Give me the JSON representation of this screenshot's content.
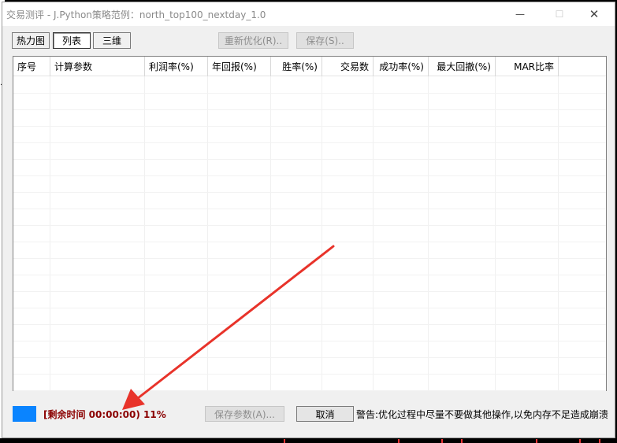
{
  "window": {
    "title": "交易测评 - J.Python策略范例：north_top100_nextday_1.0",
    "minimize_glyph": "—",
    "maximize_glyph": "☐",
    "close_glyph": "✕"
  },
  "toolbar": {
    "tabs": [
      {
        "label": "热力图",
        "active": false
      },
      {
        "label": "列表",
        "active": true
      },
      {
        "label": "三维",
        "active": false
      }
    ],
    "reoptimize_label": "重新优化(R)..",
    "save_label": "保存(S).."
  },
  "table": {
    "columns": [
      "序号",
      "计算参数",
      "利润率(%)",
      "年回报(%)",
      "胜率(%)",
      "交易数",
      "成功率(%)",
      "最大回撤(%)",
      "MAR比率"
    ],
    "rows": []
  },
  "status": {
    "time_text": "[剩余时间 00:00:00) 11%",
    "progress_percent": 11,
    "progress_color": "#0a84ff",
    "save_params_label": "保存参数(A)...",
    "cancel_label": "取消",
    "warning_text": "警告:优化过程中尽量不要做其他操作,以免内存不足造成崩溃"
  },
  "annotation": {
    "arrow_color": "#e8332a"
  }
}
